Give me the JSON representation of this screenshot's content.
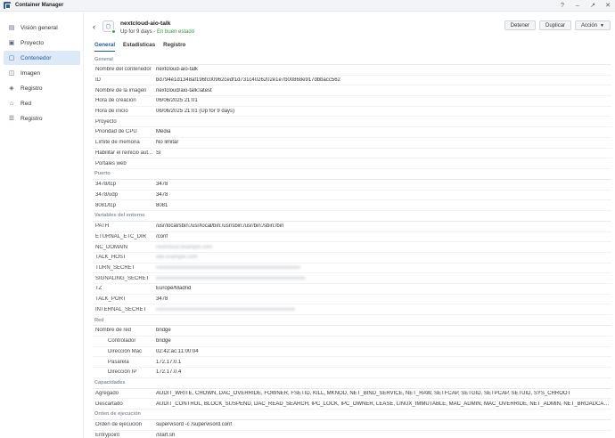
{
  "app": {
    "title": "Container Manager"
  },
  "window_controls": [
    "?",
    "–",
    "↗",
    "✕"
  ],
  "sidebar": {
    "items": [
      {
        "label": "Visión general",
        "icon": "overview-icon"
      },
      {
        "label": "Proyecto",
        "icon": "project-icon"
      },
      {
        "label": "Contenedor",
        "icon": "container-icon",
        "active": true
      },
      {
        "label": "Imagen",
        "icon": "image-icon"
      },
      {
        "label": "Registro",
        "icon": "registry-icon"
      },
      {
        "label": "Red",
        "icon": "network-icon"
      },
      {
        "label": "Registro",
        "icon": "log-icon"
      }
    ]
  },
  "header": {
    "name": "nextcloud-aio-talk",
    "uptime": "Up for 9 days",
    "separator": " - ",
    "health": "En buen estado",
    "buttons": {
      "stop": "Detener",
      "duplicate": "Duplicar",
      "action": "Acción"
    }
  },
  "tabs": [
    {
      "label": "General",
      "active": true
    },
    {
      "label": "Estadísticas"
    },
    {
      "label": "Registro"
    }
  ],
  "sections": {
    "general": {
      "title": "General",
      "rows": [
        {
          "k": "Nombre del contenedor",
          "v": "nextcloud-aio-talk"
        },
        {
          "k": "ID",
          "v": "bd794e1d1348af196fc00962cedf1d731c4026202e1e7b00868e917dbbacc562"
        },
        {
          "k": "Nombre de la imagen",
          "v": "nextcloud/aio-talk:latest"
        },
        {
          "k": "Hora de creación",
          "v": "06/06/2025 21:01"
        },
        {
          "k": "Hora de inicio",
          "v": "06/06/2025 21:01 (Up for 9 days)"
        },
        {
          "k": "Proyecto",
          "v": ""
        },
        {
          "k": "Prioridad de CPU",
          "v": "Media"
        },
        {
          "k": "Límite de memoria",
          "v": "No limitar"
        },
        {
          "k": "Habilitar el reinicio aut...",
          "v": "Sí"
        },
        {
          "k": "Portales web",
          "v": ""
        }
      ]
    },
    "ports": {
      "title": "Puerto",
      "rows": [
        {
          "k": "3478/tcp",
          "v": "3478"
        },
        {
          "k": "3478/udp",
          "v": "3478"
        },
        {
          "k": "8081/tcp",
          "v": "8081"
        }
      ]
    },
    "env": {
      "title": "Variables del entorno",
      "rows": [
        {
          "k": "PATH",
          "v": "/usr/local/sbin:/usr/local/bin:/usr/sbin:/usr/bin:/sbin:/bin"
        },
        {
          "k": "ETURNAL_ETC_DIR",
          "v": "/conf"
        },
        {
          "k": "NC_DOMAIN",
          "v": "nextcloud.example.com",
          "blur": true
        },
        {
          "k": "TALK_HOST",
          "v": "talk.example.com",
          "blur": true
        },
        {
          "k": "TURN_SECRET",
          "v": "xxxxxxxxxxxxxxxxxxxxxxxxxxxxxxxxxxxxxxxxxxxxxxxxxxxxxx",
          "blur": true
        },
        {
          "k": "SIGNALING_SECRET",
          "v": "xxxxxxxxxxxxxxxxxxxxxxxxxxxxxxxxxxxxxxxxxxxxxxxxxxxxxxxx",
          "blur": true
        },
        {
          "k": "TZ",
          "v": "Europe/Madrid"
        },
        {
          "k": "TALK_PORT",
          "v": "3478"
        },
        {
          "k": "INTERNAL_SECRET",
          "v": "xxxxxxxxxxxxxxxxxxxxxxxxxxxxxxxxxxxxxxxxxxxxxxxxxxxx",
          "blur": true
        }
      ]
    },
    "network": {
      "title": "Red",
      "rows": [
        {
          "k": "Nombre de red",
          "v": "bridge"
        },
        {
          "k": "Controlador",
          "v": "bridge",
          "sub": true
        },
        {
          "k": "Dirección Mac",
          "v": "02:42:ac:11:00:04",
          "sub": true
        },
        {
          "k": "Pasarela",
          "v": "172.17.0.1",
          "sub": true
        },
        {
          "k": "Dirección IP",
          "v": "172.17.0.4",
          "sub": true
        }
      ]
    },
    "caps": {
      "title": "Capacidades",
      "rows": [
        {
          "k": "Agregado",
          "v": "AUDIT_WRITE, CHOWN, DAC_OVERRIDE, FOWNER, FSETID, KILL, MKNOD, NET_BIND_SERVICE, NET_RAW, SETFCAP, SETGID, SETPCAP, SETUID, SYS_CHROOT"
        },
        {
          "k": "Descartado",
          "v": "AUDIT_CONTROL, BLOCK_SUSPEND, DAC_READ_SEARCH, IPC_LOCK, IPC_OWNER, LEASE, LINUX_IMMUTABLE, MAC_ADMIN, MAC_OVERRIDE, NET_ADMIN, NET_BROADCAST, SYSL..."
        }
      ]
    },
    "exec": {
      "title": "Orden de ejecución",
      "rows": [
        {
          "k": "Orden de ejecución",
          "v": "supervisord -c /supervisord.conf"
        },
        {
          "k": "Entrypoint",
          "v": "/start.sh"
        }
      ]
    }
  }
}
